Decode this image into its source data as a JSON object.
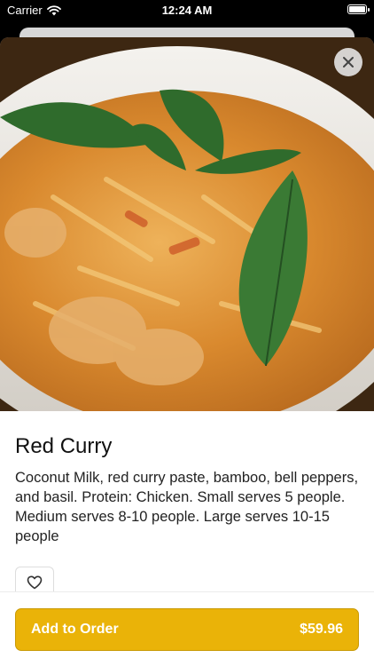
{
  "status_bar": {
    "carrier": "Carrier",
    "time": "12:24 AM"
  },
  "item": {
    "name": "Red Curry",
    "description": "Coconut Milk, red curry paste, bamboo, bell peppers, and basil. Protein: Chicken. Small serves 5 people. Medium serves 8-10 people. Large serves 10-15 people"
  },
  "icons": {
    "close": "close-icon",
    "favorite": "heart-icon"
  },
  "order": {
    "label": "Add to Order",
    "price": "$59.96"
  },
  "colors": {
    "accent": "#EAB308",
    "curry": "#D9892E",
    "basil": "#2F6B2C"
  }
}
